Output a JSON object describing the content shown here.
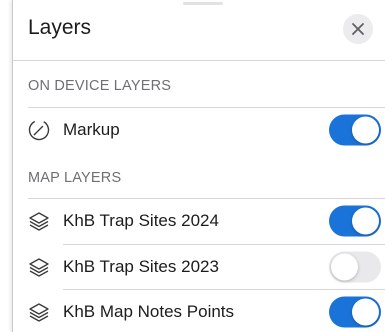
{
  "panel": {
    "title": "Layers",
    "close_icon": "close-icon"
  },
  "sections": {
    "on_device": {
      "header": "ON DEVICE LAYERS",
      "items": [
        {
          "label": "Markup",
          "icon": "markup-pen-circle-icon",
          "enabled": true
        }
      ]
    },
    "map": {
      "header": "MAP LAYERS",
      "items": [
        {
          "label": "KhB Trap Sites 2024",
          "icon": "layers-stack-icon",
          "enabled": true
        },
        {
          "label": "KhB Trap Sites 2023",
          "icon": "layers-stack-icon",
          "enabled": false
        },
        {
          "label": "KhB Map Notes Points",
          "icon": "layers-stack-icon",
          "enabled": true
        }
      ]
    }
  },
  "colors": {
    "toggle_on": "#1a73d9",
    "toggle_off": "#e9e9eb",
    "section_header": "#6f6f74",
    "divider": "#d8d8dc"
  }
}
